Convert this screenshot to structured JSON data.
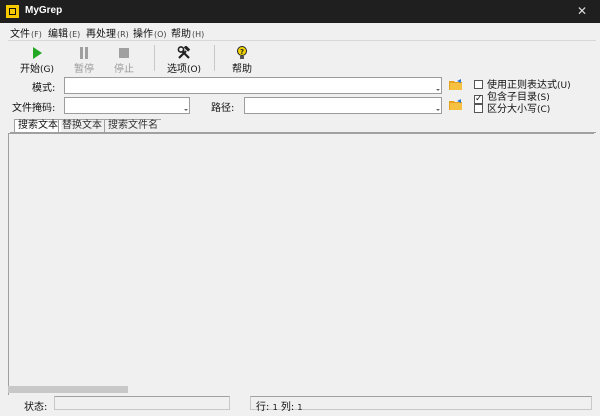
{
  "window": {
    "title": "MyGrep",
    "close_glyph": "✕"
  },
  "menu": [
    {
      "label": "文件",
      "accel": "(F)"
    },
    {
      "label": "编辑",
      "accel": "(E)"
    },
    {
      "label": "再处理",
      "accel": "(R)"
    },
    {
      "label": "操作",
      "accel": "(O)"
    },
    {
      "label": "帮助",
      "accel": "(H)"
    }
  ],
  "toolbar": {
    "start": {
      "label": "开始",
      "accel": "(G)",
      "icon": "play-icon",
      "color": "#22a822"
    },
    "pause": {
      "label": "暂停",
      "icon": "pause-icon",
      "disabled": true
    },
    "stop": {
      "label": "停止",
      "icon": "stop-icon",
      "disabled": true
    },
    "options": {
      "label": "选项",
      "accel": "(O)",
      "icon": "tools-icon"
    },
    "help": {
      "label": "帮助",
      "icon": "question-bulb-icon"
    }
  },
  "form": {
    "pattern_label": "模式:",
    "pattern_value": "",
    "file_mask_label": "文件掩码:",
    "file_mask_value": "",
    "path_label": "路径:",
    "path_value": ""
  },
  "options": [
    {
      "label": "使用正则表达式",
      "accel": "(U)",
      "checked": false
    },
    {
      "label": "包含子目录",
      "accel": "(S)",
      "checked": true
    },
    {
      "label": "区分大小写",
      "accel": "(C)",
      "checked": false
    }
  ],
  "tabs": [
    {
      "label": "搜索文本",
      "active": true
    },
    {
      "label": "替换文本",
      "active": false
    },
    {
      "label": "搜索文件名",
      "active": false
    }
  ],
  "status": {
    "status_label": "状态:",
    "status_value": "",
    "row_label": "行:",
    "row_value": "1",
    "col_label": "列:",
    "col_value": "1"
  }
}
